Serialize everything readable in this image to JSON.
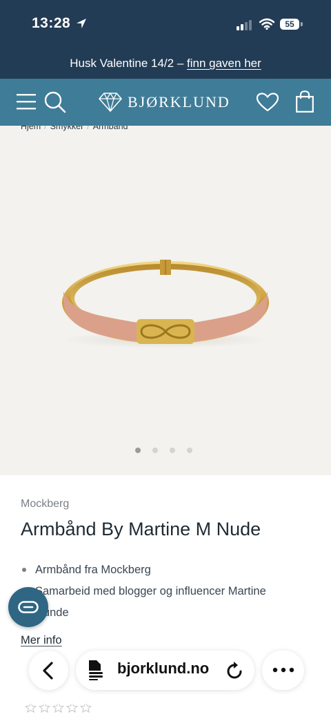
{
  "status_bar": {
    "time": "13:28",
    "battery": "55"
  },
  "promo": {
    "text": "Husk Valentine 14/2  – ",
    "link": "finn gaven her"
  },
  "header": {
    "logo_text": "BJØRKLUND"
  },
  "breadcrumb": [
    "Hjem",
    "Smykker",
    "Armbånd"
  ],
  "carousel": {
    "total": 4,
    "active_index": 0
  },
  "product": {
    "brand": "Mockberg",
    "title": "Armbånd By Martine M Nude",
    "bullets": [
      "Armbånd fra Mockberg",
      "Samarbeid med blogger og influencer Martine Nunde"
    ],
    "more_info": "Mer info",
    "rating": 0
  },
  "browser": {
    "url": "bjorklund.no"
  },
  "colors": {
    "navy": "#233c55",
    "header_teal": "#3f7c97",
    "hero_bg": "#f3f2ee",
    "bracelet_gold": "#d6b24a",
    "enamel_nude": "#dba08a"
  }
}
